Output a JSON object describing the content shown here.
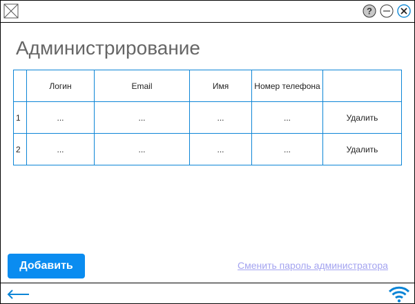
{
  "window": {
    "icons": {
      "app": "image-placeholder-icon",
      "help": "help-icon",
      "minimize": "minimize-icon",
      "close": "close-icon"
    }
  },
  "page": {
    "title": "Администрирование"
  },
  "table": {
    "headers": {
      "num": "",
      "login": "Логин",
      "email": "Email",
      "name": "Имя",
      "phone": "Номер телефона",
      "action": ""
    },
    "rows": [
      {
        "num": "1",
        "login": "...",
        "email": "...",
        "name": "...",
        "phone": "...",
        "action": "Удалить"
      },
      {
        "num": "2",
        "login": "...",
        "email": "...",
        "name": "...",
        "phone": "...",
        "action": "Удалить"
      }
    ]
  },
  "actions": {
    "add_label": "Добавить",
    "change_password_label": "Сменить пароль администратора"
  },
  "footer": {
    "icons": {
      "back": "back-arrow-icon",
      "wifi": "wifi-icon"
    }
  },
  "colors": {
    "accent": "#0a8cf0",
    "grid_border": "#0a84d6",
    "title_text": "#666666",
    "link": "#a3a3f0"
  }
}
